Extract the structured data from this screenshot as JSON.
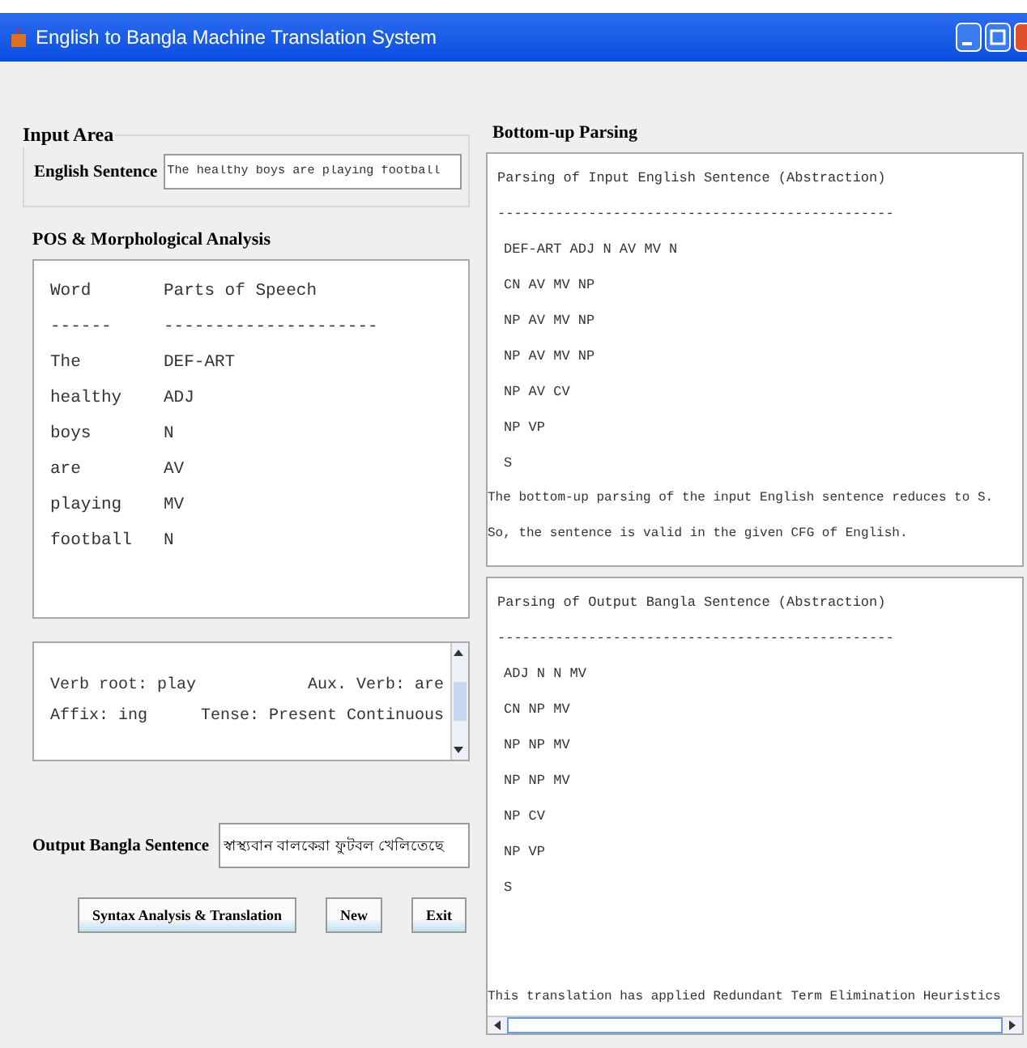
{
  "window": {
    "title": "English to Bangla Machine Translation System"
  },
  "input_area": {
    "title": "Input Area",
    "label": "English Sentence",
    "value": "The healthy boys are playing football"
  },
  "pos_analysis": {
    "title": "POS & Morphological Analysis",
    "headers": [
      "Word",
      "Parts of Speech"
    ],
    "separators": [
      "------",
      "---------------------"
    ],
    "rows": [
      {
        "word": "The",
        "pos": "DEF-ART"
      },
      {
        "word": "healthy",
        "pos": "ADJ"
      },
      {
        "word": "boys",
        "pos": "N"
      },
      {
        "word": "are",
        "pos": "AV"
      },
      {
        "word": "playing",
        "pos": "MV"
      },
      {
        "word": "football",
        "pos": "N"
      }
    ]
  },
  "morphology": {
    "items": [
      "Verb root: play",
      "Aux. Verb: are",
      "Affix: ing",
      "Tense: Present Continuous"
    ]
  },
  "output": {
    "label": "Output Bangla Sentence",
    "value": "স্বাস্থ্যবান বালকেরা ফুটবল খেলিতেছে"
  },
  "buttons": [
    "Syntax Analysis & Translation",
    "New",
    "Exit"
  ],
  "parsing": {
    "title": "Bottom-up Parsing",
    "input_parse": {
      "heading": "Parsing of Input English Sentence (Abstraction)",
      "rule": "------------------------------------------------",
      "steps": [
        "DEF-ART  ADJ  N  AV  MV  N",
        "CN  AV  MV  NP",
        "NP  AV  MV  NP",
        "NP  AV  MV  NP",
        "NP  AV  CV",
        "NP  VP",
        "S"
      ],
      "notes": [
        "The bottom-up parsing of the input English sentence reduces to S.",
        "So, the sentence is valid in the given CFG of English."
      ]
    },
    "output_parse": {
      "heading": "Parsing of Output Bangla Sentence (Abstraction)",
      "rule": "------------------------------------------------",
      "steps": [
        "ADJ  N  N  MV",
        "CN  NP  MV",
        "NP  NP  MV",
        "NP  NP  MV",
        "NP  CV",
        "NP  VP",
        "S"
      ],
      "notes": [
        "This translation has applied Redundant Term Elimination Heuristics"
      ]
    }
  }
}
